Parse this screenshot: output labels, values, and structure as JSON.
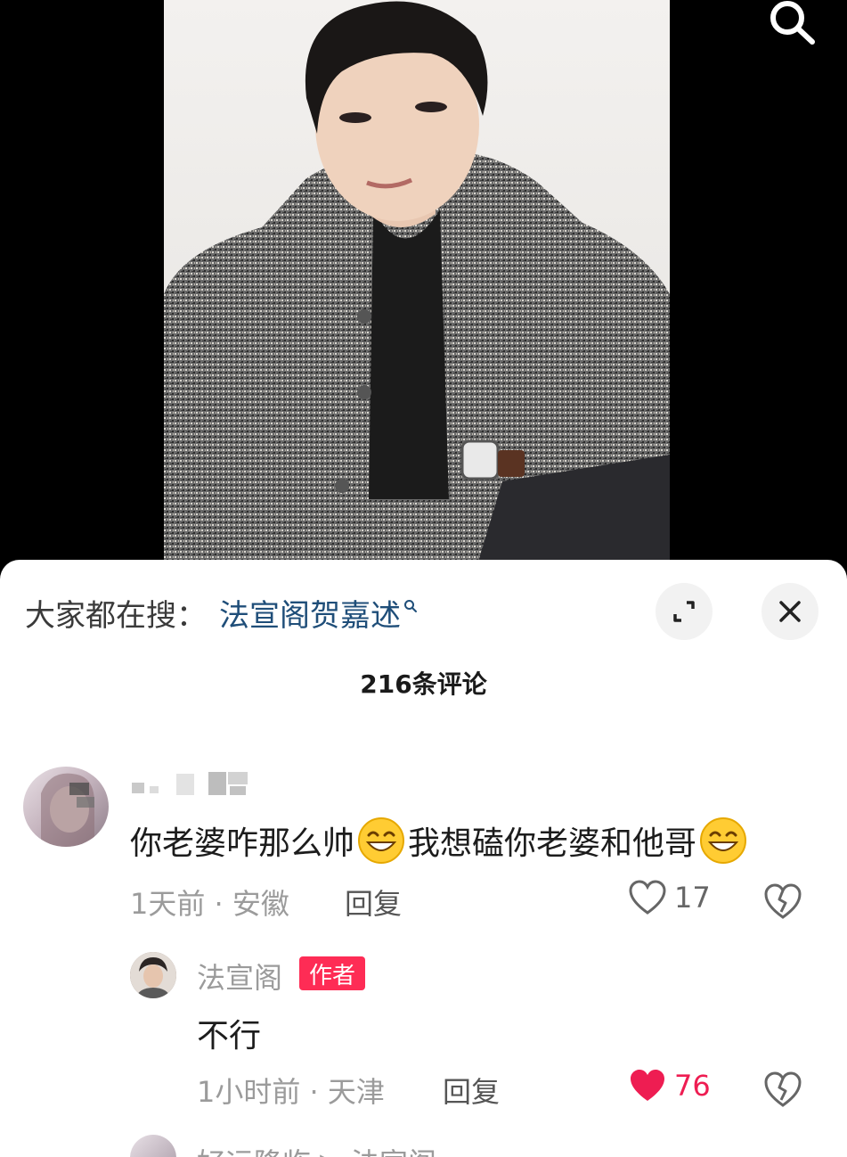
{
  "top": {
    "search_icon": "search-icon"
  },
  "media": {
    "alt": "portrait photo"
  },
  "sheet": {
    "hot_search_prefix": "大家都在搜：",
    "hot_search_term": "法宣阁贺嘉述",
    "expand_icon": "expand-icon",
    "close_icon": "close-icon",
    "comment_count_title": "216条评论"
  },
  "comments": [
    {
      "text_part1": "你老婆咋那么帅",
      "text_part2": "我想磕你老婆和他哥",
      "emoji": "grinning-face",
      "time": "1天前",
      "location": "安徽",
      "reply_label": "回复",
      "likes": "17",
      "liked": false
    },
    {
      "username": "法宣阁",
      "badge": "作者",
      "text": "不行",
      "time": "1小时前",
      "location": "天津",
      "reply_label": "回复",
      "likes": "76",
      "liked": true
    },
    {
      "username_line": "好运降临 ▶ 法宣阁"
    }
  ],
  "colors": {
    "link_blue": "#1f4e79",
    "badge_red": "#fe2c55",
    "like_red": "#ee1d52",
    "meta_gray": "#9b9b9b"
  }
}
